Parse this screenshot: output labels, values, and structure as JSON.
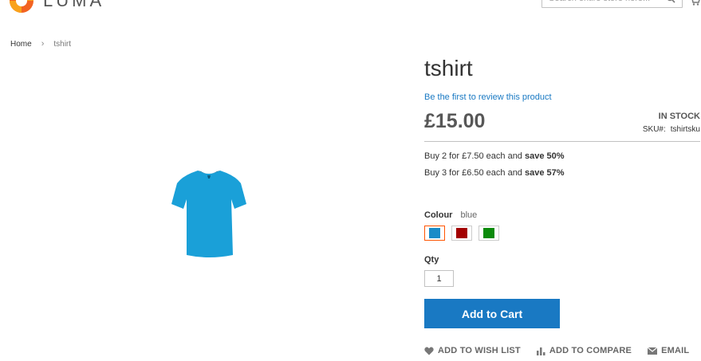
{
  "header": {
    "logo_text": "LUMA",
    "search_placeholder": "Search entire store here..."
  },
  "breadcrumbs": {
    "home": "Home",
    "separator": "›",
    "current": "tshirt"
  },
  "product": {
    "name": "tshirt",
    "review_link": "Be the first to review this product",
    "price": "£15.00",
    "stock": "IN STOCK",
    "sku_label": "SKU#:",
    "sku": "tshirtsku",
    "tier_prices": [
      {
        "text": "Buy 2 for £7.50 each and ",
        "save": "save 50%"
      },
      {
        "text": "Buy 3 for £6.50 each and ",
        "save": "save 57%"
      }
    ],
    "colour_label": "Colour",
    "colour_selected": "blue",
    "swatches": [
      {
        "name": "blue",
        "color": "#1a8cc8"
      },
      {
        "name": "red",
        "color": "#a30000"
      },
      {
        "name": "green",
        "color": "#0a8a0a"
      }
    ],
    "qty_label": "Qty",
    "qty_value": "1",
    "add_to_cart": "Add to Cart",
    "actions": {
      "wishlist": "Add to Wish List",
      "compare": "Add to Compare",
      "email": "Email"
    },
    "tshirt_color": "#1aa0d8"
  },
  "colors": {
    "accent": "#1979c3",
    "selected_border": "#ff5501"
  }
}
